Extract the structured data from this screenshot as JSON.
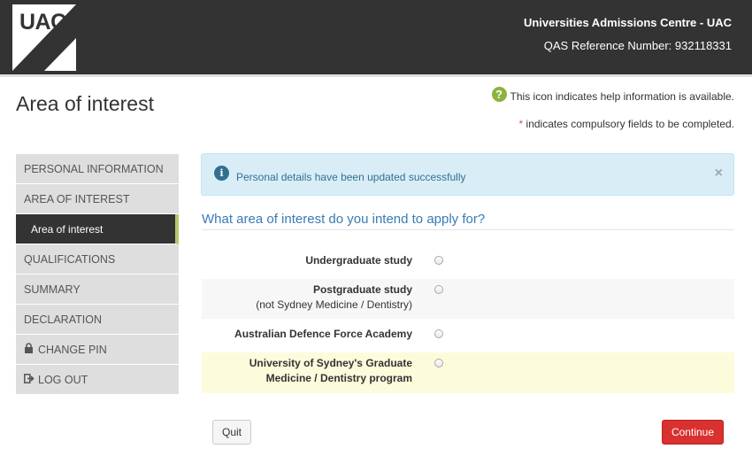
{
  "header": {
    "logo_text": "UAC",
    "title": "Universities Admissions Centre - UAC",
    "reference": "QAS Reference Number: 932118331"
  },
  "page": {
    "title": "Area of interest",
    "help_note": "This icon indicates help information is available.",
    "help_icon_glyph": "?",
    "required_star": "*",
    "required_note": " indicates compulsory fields to be completed."
  },
  "sidebar": {
    "items": [
      {
        "label": "PERSONAL INFORMATION"
      },
      {
        "label": "AREA OF INTEREST"
      },
      {
        "label": "Area of interest",
        "active": true
      },
      {
        "label": "QUALIFICATIONS"
      },
      {
        "label": "SUMMARY"
      },
      {
        "label": "DECLARATION"
      },
      {
        "label": "CHANGE PIN",
        "icon": "lock-icon"
      },
      {
        "label": "LOG OUT",
        "icon": "logout-icon"
      }
    ]
  },
  "alert": {
    "icon_glyph": "i",
    "message": "Personal details have been updated successfully",
    "close_glyph": "×"
  },
  "form": {
    "question": "What area of interest do you intend to apply for?",
    "options": [
      {
        "line1": "Undergraduate study",
        "line2": ""
      },
      {
        "line1": "Postgraduate study",
        "line2": "(not Sydney Medicine / Dentistry)"
      },
      {
        "line1": "Australian Defence Force Academy",
        "line2": ""
      },
      {
        "line1": "University of Sydney's Graduate",
        "line2": "Medicine / Dentistry program"
      }
    ]
  },
  "buttons": {
    "quit": "Quit",
    "continue": "Continue"
  },
  "colors": {
    "header_bg": "#333333",
    "help_icon": "#8cb33b",
    "alert_bg": "#d9edf7",
    "question_text": "#3a7ab5",
    "continue_bg": "#d9312f",
    "active_accent": "#b7c76b"
  }
}
